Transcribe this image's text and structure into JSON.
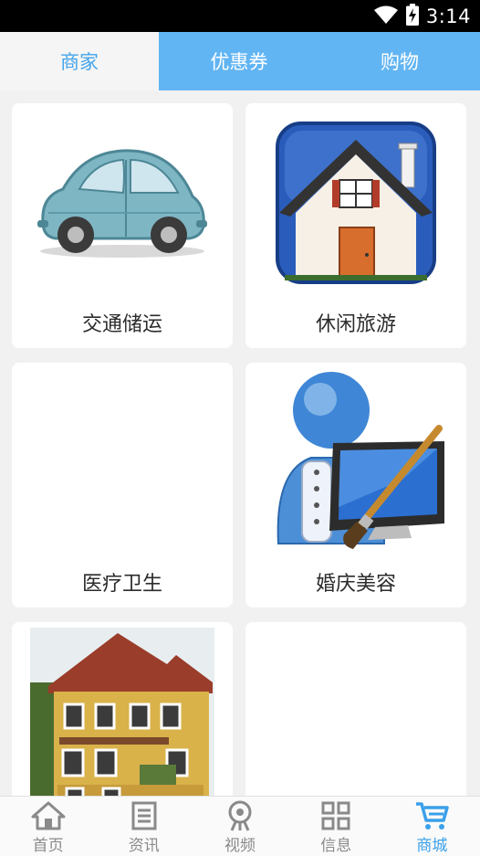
{
  "status": {
    "time": "3:14"
  },
  "tabs": [
    {
      "label": "商家"
    },
    {
      "label": "优惠券"
    },
    {
      "label": "购物"
    }
  ],
  "categories": [
    {
      "label": "交通储运",
      "icon": "car-icon"
    },
    {
      "label": "休闲旅游",
      "icon": "house-icon"
    },
    {
      "label": "医疗卫生",
      "icon": ""
    },
    {
      "label": "婚庆美容",
      "icon": "user-paint-icon"
    },
    {
      "label": "",
      "icon": "building-photo"
    },
    {
      "label": "",
      "icon": ""
    }
  ],
  "bottom_nav": [
    {
      "label": "首页",
      "icon": "home-icon"
    },
    {
      "label": "资讯",
      "icon": "news-icon"
    },
    {
      "label": "视频",
      "icon": "video-icon"
    },
    {
      "label": "信息",
      "icon": "grid-icon"
    },
    {
      "label": "商城",
      "icon": "cart-icon",
      "active": true
    }
  ],
  "colors": {
    "accent": "#45a4ea",
    "tab_bar": "#62b5f3"
  }
}
